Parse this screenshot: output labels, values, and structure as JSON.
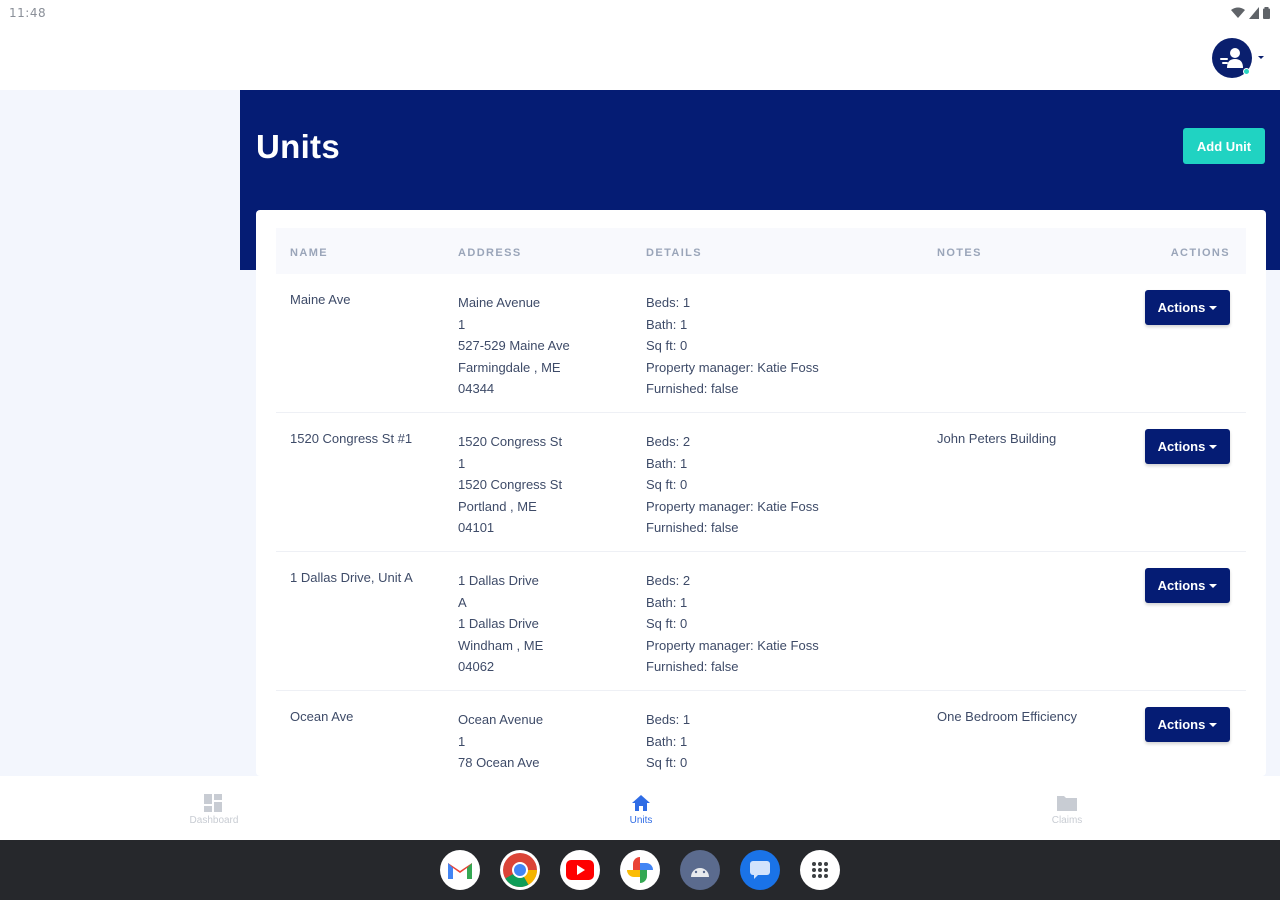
{
  "status_bar": {
    "time": "11:48"
  },
  "header": {
    "avatar_icon": "user-avatar-icon"
  },
  "page": {
    "title": "Units",
    "add_button_label": "Add Unit"
  },
  "table": {
    "columns": {
      "name": "NAME",
      "address": "ADDRESS",
      "details": "DETAILS",
      "notes": "NOTES",
      "actions": "ACTIONS"
    },
    "actions_label": "Actions",
    "rows": [
      {
        "name": "Maine Ave",
        "address": [
          "Maine Avenue",
          "1",
          "527-529 Maine Ave",
          "Farmingdale , ME",
          "04344"
        ],
        "details": [
          "Beds: 1",
          "Bath: 1",
          "Sq ft: 0",
          "Property manager: Katie Foss",
          "Furnished: false"
        ],
        "notes": ""
      },
      {
        "name": "1520 Congress St #1",
        "address": [
          "1520 Congress St",
          "1",
          "1520 Congress St",
          "Portland , ME",
          "04101"
        ],
        "details": [
          "Beds: 2",
          "Bath: 1",
          "Sq ft: 0",
          "Property manager: Katie Foss",
          "Furnished: false"
        ],
        "notes": "John Peters Building"
      },
      {
        "name": "1 Dallas Drive, Unit A",
        "address": [
          "1 Dallas Drive",
          "A",
          "1 Dallas Drive",
          "Windham , ME",
          "04062"
        ],
        "details": [
          "Beds: 2",
          "Bath: 1",
          "Sq ft: 0",
          "Property manager: Katie Foss",
          "Furnished: false"
        ],
        "notes": ""
      },
      {
        "name": "Ocean Ave",
        "address": [
          "Ocean Avenue",
          "1",
          "78 Ocean Ave"
        ],
        "details": [
          "Beds: 1",
          "Bath: 1",
          "Sq ft: 0"
        ],
        "notes": "One Bedroom Efficiency"
      }
    ]
  },
  "bottom_nav": {
    "items": [
      {
        "label": "Dashboard",
        "icon": "dashboard-icon",
        "active": false
      },
      {
        "label": "Units",
        "icon": "home-icon",
        "active": true
      },
      {
        "label": "Claims",
        "icon": "folder-icon",
        "active": false
      }
    ]
  },
  "taskbar": {
    "apps": [
      "gmail-icon",
      "chrome-icon",
      "youtube-icon",
      "photos-icon",
      "android-icon",
      "messages-icon",
      "app-drawer-icon"
    ]
  },
  "colors": {
    "primary": "#051c74",
    "accent": "#20d3c2",
    "active_nav": "#2f6ce5",
    "background": "#f3f6fd"
  }
}
